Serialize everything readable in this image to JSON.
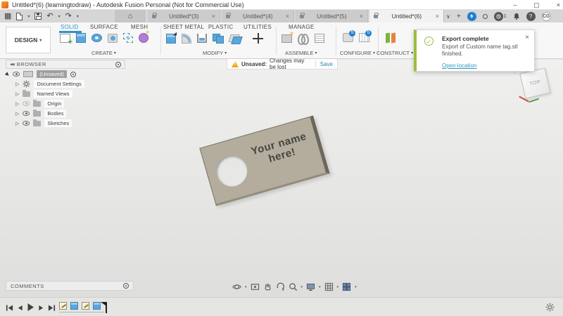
{
  "titlebar": {
    "title": "Untitled*(6) (learningtodraw) - Autodesk Fusion Personal (Not for Commercial Use)"
  },
  "icons": {
    "app_grid": "▦",
    "caret": "▾",
    "undo": "↶",
    "redo": "↷",
    "home": "⌂",
    "close": "×",
    "chevron_down": "∨",
    "new_tab": "+",
    "minimize": "–",
    "maximize": "▢",
    "help": "?",
    "check": "✓",
    "collapse_left": "◀◀",
    "tri_expanded": "▶",
    "tri_collapsed": "▷"
  },
  "tabbar": {
    "tabs": [
      {
        "label": "Untitled*(3)",
        "active": false
      },
      {
        "label": "Untitled*(4)",
        "active": false
      },
      {
        "label": "Untitled*(5)",
        "active": false
      },
      {
        "label": "Untitled*(6)",
        "active": true
      }
    ],
    "notification_count": "1",
    "avatar": "CG"
  },
  "ribbon": {
    "design_button": "DESIGN",
    "tabs": [
      {
        "label": "SOLID",
        "active": true
      },
      {
        "label": "SURFACE",
        "active": false
      },
      {
        "label": "MESH",
        "active": false
      },
      {
        "label": "SHEET METAL",
        "active": false
      },
      {
        "label": "PLASTIC",
        "active": false
      },
      {
        "label": "UTILITIES",
        "active": false
      },
      {
        "label": "MANAGE",
        "active": false
      }
    ],
    "groups": [
      {
        "label": "CREATE"
      },
      {
        "label": "MODIFY"
      },
      {
        "label": "ASSEMBLE"
      },
      {
        "label": "CONFIGURE"
      },
      {
        "label": "CONSTRUCT"
      }
    ]
  },
  "unsaved_bar": {
    "status": "Unsaved:",
    "message": "Changes may be lost",
    "action": "Save"
  },
  "toast": {
    "title": "Export complete",
    "body": "Export of Custom name tag.stl finished.",
    "link": "Open location"
  },
  "browser": {
    "title": "BROWSER",
    "root_label": "(Unsaved)",
    "items": [
      {
        "label": "Document Settings"
      },
      {
        "label": "Named Views"
      },
      {
        "label": "Origin"
      },
      {
        "label": "Bodies"
      },
      {
        "label": "Sketches"
      }
    ]
  },
  "viewport": {
    "tag_line1": "Your name",
    "tag_line2": "here!",
    "viewcube_face": "TOP"
  },
  "comments": {
    "title": "COMMENTS"
  },
  "colors": {
    "accent_blue": "#2f94c9",
    "success_green": "#9bbf3b",
    "warning_orange": "#f2a71b",
    "save_link": "#2c87ba",
    "tag_body": "#b4ad9e"
  }
}
